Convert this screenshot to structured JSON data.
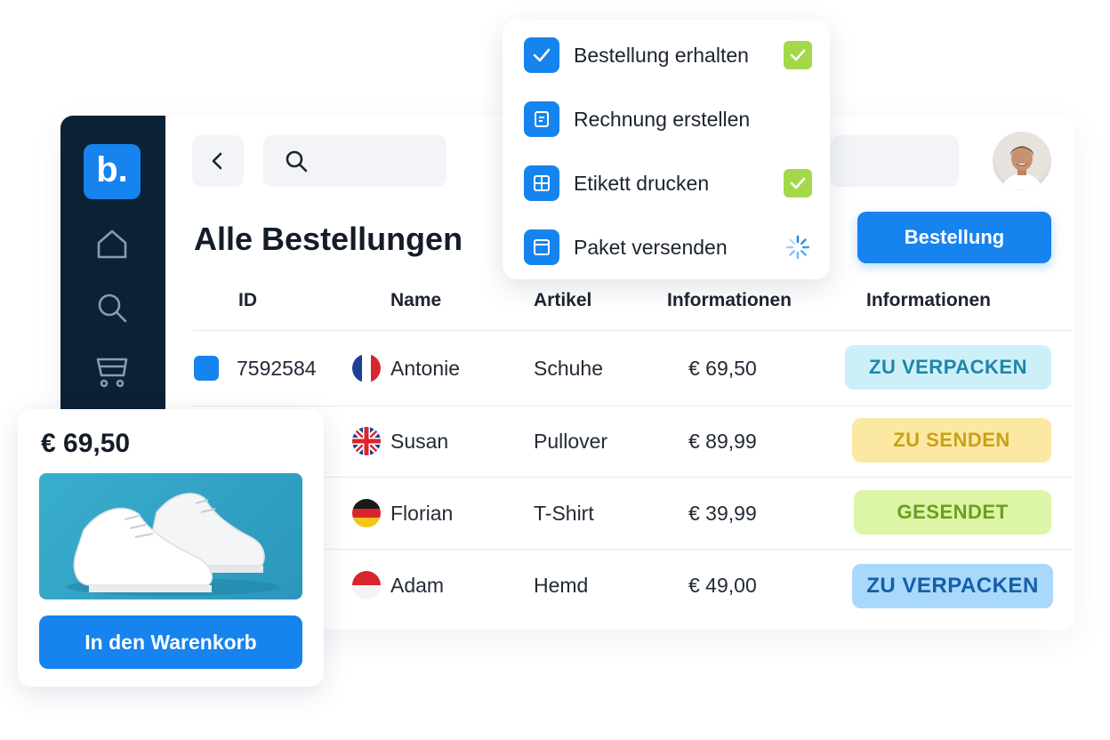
{
  "header": {
    "search_placeholder": "",
    "back_icon": "chevron-left-icon",
    "search_icon": "search-icon"
  },
  "page": {
    "title": "Alle Bestellungen",
    "primary_button": "Bestellung"
  },
  "sidebar": {
    "logo": "b.",
    "items": [
      {
        "icon": "home-icon"
      },
      {
        "icon": "search-icon"
      },
      {
        "icon": "cart-icon"
      }
    ]
  },
  "table": {
    "headers": [
      "ID",
      "Name",
      "Artikel",
      "Informationen",
      "Informationen"
    ],
    "rows": [
      {
        "id": "7592584",
        "name": "Antonie",
        "flag": "france",
        "article": "Schuhe",
        "price": "€ 69,50",
        "status": "ZU VERPACKEN"
      },
      {
        "id": "",
        "name": "Susan",
        "flag": "uk",
        "article": "Pullover",
        "price": "€ 89,99",
        "status": "ZU SENDEN"
      },
      {
        "id": "",
        "name": "Florian",
        "flag": "germany",
        "article": "T-Shirt",
        "price": "€ 39,99",
        "status": "GESENDET"
      },
      {
        "id": "",
        "name": "Adam",
        "flag": "indonesia",
        "article": "Hemd",
        "price": "€ 49,00",
        "status": "ZU VERPACKEN"
      }
    ]
  },
  "status_colors": {
    "zu_verpacken_bg": "#cdf0f8",
    "zu_verpacken_fg": "#1d86a8",
    "zu_senden_bg": "#fbe9a2",
    "zu_senden_fg": "#caa01a",
    "gesendet_bg": "#dcf5a6",
    "gesendet_fg": "#6b9e1e",
    "zu_verpacken2_bg": "#a8d8fb",
    "zu_verpacken2_fg": "#155ea8"
  },
  "dropdown": {
    "items": [
      {
        "label": "Bestellung erhalten",
        "icon": "check-icon",
        "state": "done"
      },
      {
        "label": "Rechnung erstellen",
        "icon": "invoice-icon",
        "state": "none"
      },
      {
        "label": "Etikett drucken",
        "icon": "label-grid-icon",
        "state": "done"
      },
      {
        "label": "Paket versenden",
        "icon": "package-icon",
        "state": "loading"
      }
    ]
  },
  "product_card": {
    "price": "€ 69,50",
    "image": "white-sneakers-image",
    "button": "In den Warenkorb"
  },
  "colors": {
    "accent": "#1683ee",
    "sidebar": "#0b2136",
    "done_check": "#a3d84a"
  }
}
